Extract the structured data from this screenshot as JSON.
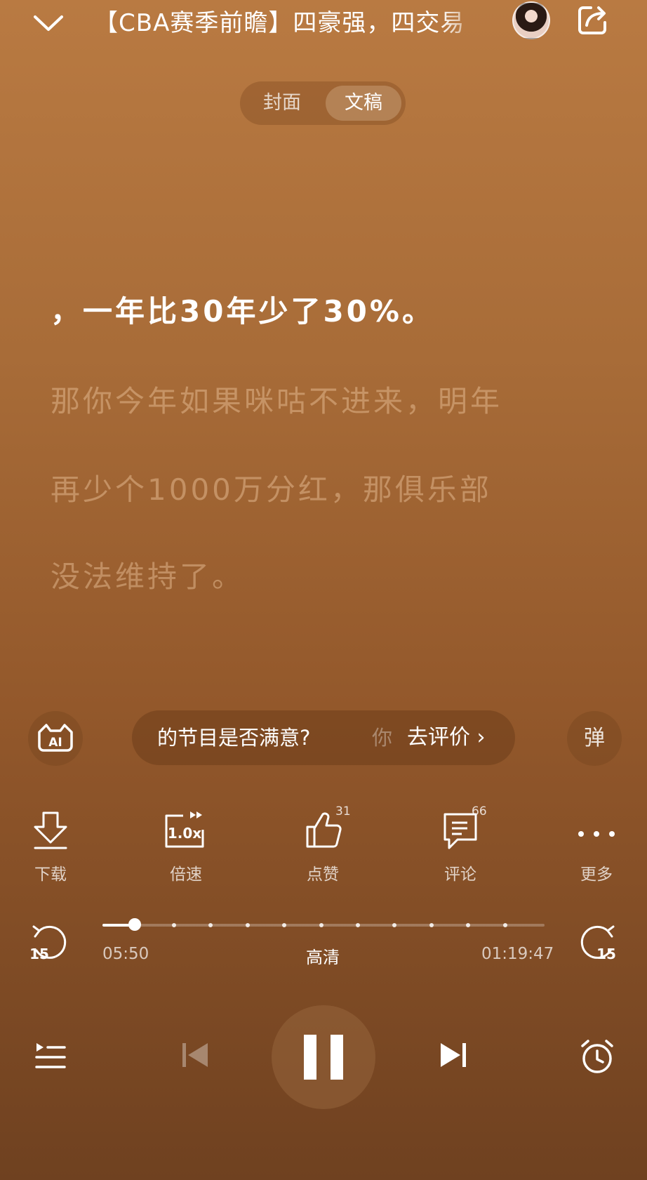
{
  "header": {
    "title": "【CBA赛季前瞻】四豪强，四交易"
  },
  "segment": {
    "tabs": [
      "封面",
      "文稿"
    ],
    "selected": "文稿"
  },
  "transcript": {
    "active_line": "，一年比30年少了30%。",
    "lines": [
      "那你今年如果咪咕不进来，明年",
      "再少个1000万分红，那俱乐部",
      "没法维持了。"
    ]
  },
  "prompt": {
    "text": "的节目是否满意?",
    "ghost": "你",
    "action": "去评价 ›"
  },
  "danmu": {
    "label": "弹"
  },
  "actions": [
    {
      "label": "下载",
      "icon": "download-icon"
    },
    {
      "label": "倍速",
      "icon": "speed-icon",
      "value": "1.0x"
    },
    {
      "label": "点赞",
      "icon": "thumbs-up-icon",
      "count": "31"
    },
    {
      "label": "评论",
      "icon": "comment-icon",
      "count": "66"
    },
    {
      "label": "更多",
      "icon": "more-icon"
    }
  ],
  "player": {
    "current_time": "05:50",
    "total_time": "01:19:47",
    "quality": "高清",
    "progress": 0.073,
    "skip_back": "15",
    "skip_forward": "15",
    "state": "playing"
  }
}
